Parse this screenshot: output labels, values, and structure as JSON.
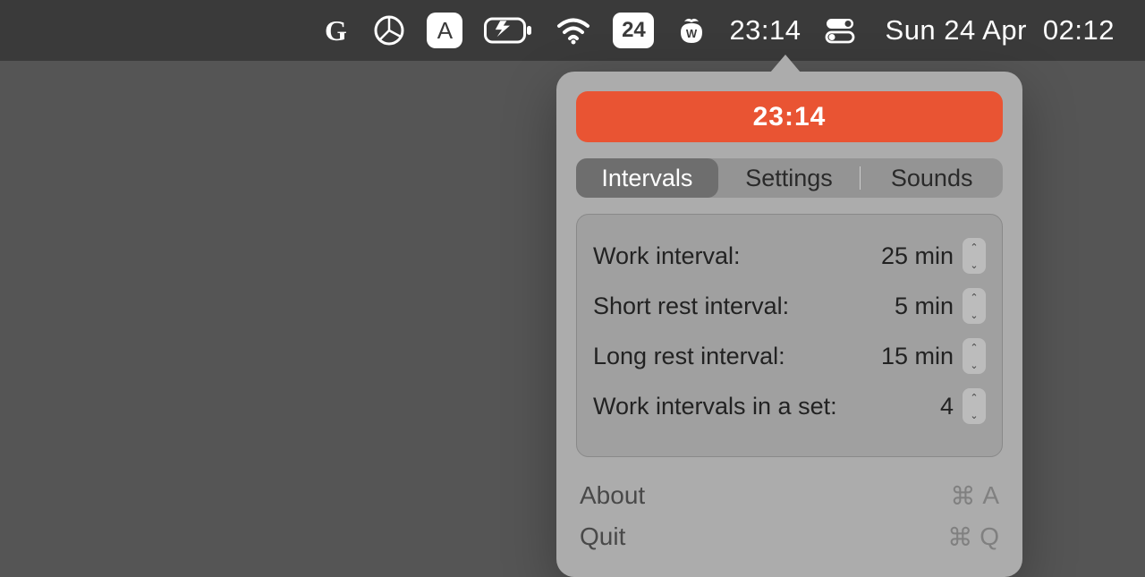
{
  "menubar": {
    "items": {
      "g_icon": "G",
      "calendar_badge": "24",
      "timer_text": "23:14"
    },
    "datetime": {
      "day_date": "Sun 24 Apr",
      "time": "02:12"
    }
  },
  "popover": {
    "timer_display": "23:14",
    "tabs": [
      {
        "label": "Intervals",
        "active": true
      },
      {
        "label": "Settings",
        "active": false
      },
      {
        "label": "Sounds",
        "active": false
      }
    ],
    "settings": [
      {
        "label": "Work interval:",
        "value": "25 min"
      },
      {
        "label": "Short rest interval:",
        "value": "5 min"
      },
      {
        "label": "Long rest interval:",
        "value": "15 min"
      },
      {
        "label": "Work intervals in a set:",
        "value": "4"
      }
    ],
    "footer": [
      {
        "label": "About",
        "shortcut_symbol": "⌘",
        "shortcut_key": "A"
      },
      {
        "label": "Quit",
        "shortcut_symbol": "⌘",
        "shortcut_key": "Q"
      }
    ]
  },
  "colors": {
    "accent": "#e95433",
    "popover_bg": "#acacac"
  }
}
